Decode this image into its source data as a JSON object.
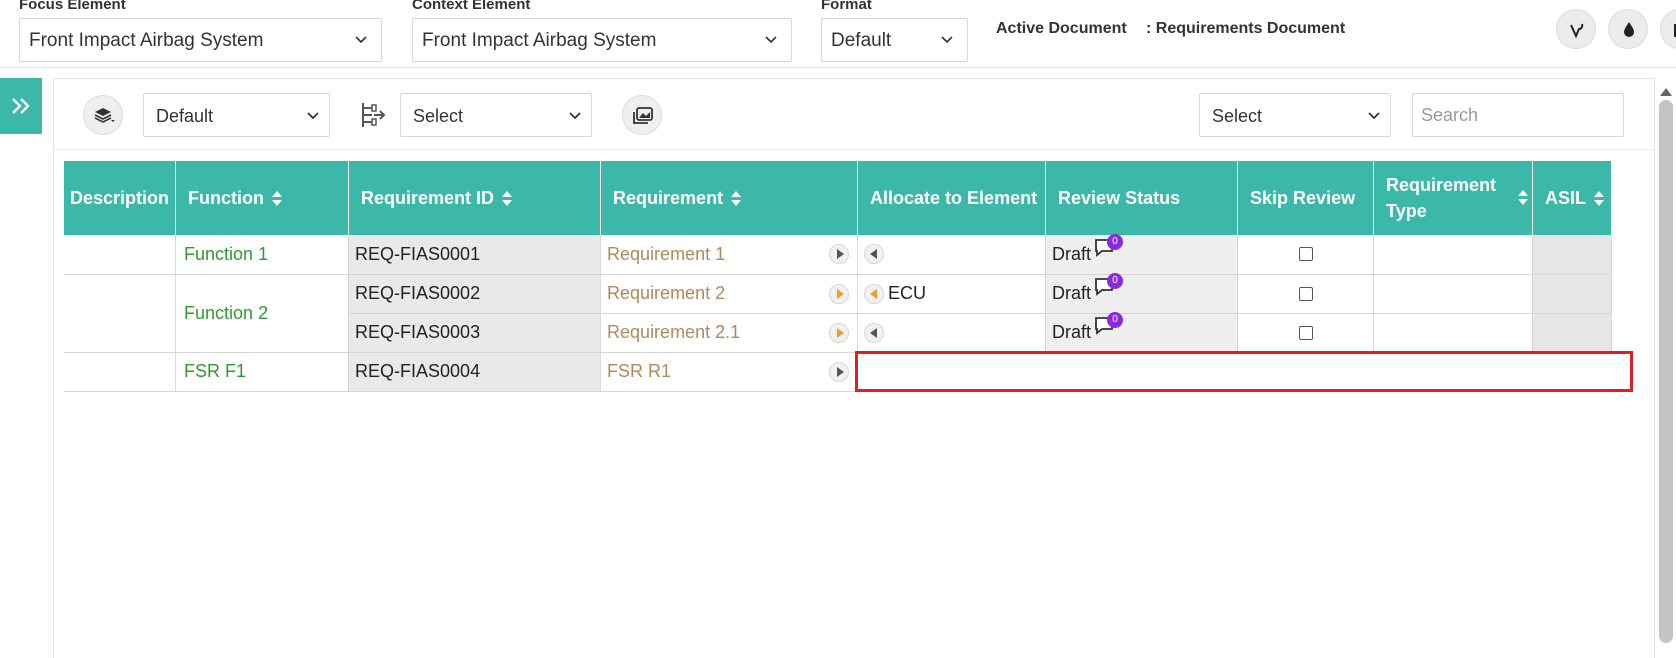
{
  "top": {
    "focus_label": "Focus Element",
    "focus_value": "Front Impact Airbag System",
    "context_label": "Context Element",
    "context_value": "Front Impact Airbag System",
    "format_label": "Format",
    "format_value": "Default",
    "active_doc_label": "Active Document",
    "active_doc_value": ": Requirements Document",
    "icons": [
      "vine-icon",
      "drop-icon",
      "partial-icon"
    ]
  },
  "toolbar": {
    "layer_select": "Default",
    "hierarchy_select": "Select",
    "right_select": "Select",
    "search_placeholder": "Search"
  },
  "table": {
    "headers": {
      "description": "Description",
      "function": "Function",
      "requirement_id": "Requirement ID",
      "requirement": "Requirement",
      "allocate": "Allocate to Element",
      "review_status": "Review Status",
      "skip_review": "Skip Review",
      "requirement_type": "Requirement Type",
      "asil": "ASIL"
    },
    "rows": [
      {
        "function": "Function 1",
        "id": "REQ-FIAS0001",
        "requirement": "Requirement 1",
        "allocate": "",
        "status": "Draft",
        "comments": "0"
      },
      {
        "function": "Function 2",
        "id": "REQ-FIAS0002",
        "requirement": "Requirement 2",
        "allocate": "ECU",
        "status": "Draft",
        "comments": "0"
      },
      {
        "function": "",
        "id": "REQ-FIAS0003",
        "requirement": "Requirement 2.1",
        "allocate": "",
        "status": "Draft",
        "comments": "0"
      },
      {
        "function": "FSR F1",
        "id": "REQ-FIAS0004",
        "requirement": "FSR R1",
        "allocate": "",
        "status": "",
        "comments": ""
      }
    ]
  },
  "colors": {
    "accent": "#3bb8a8",
    "function_text": "#2f9a2f",
    "requirement_text": "#b2875a",
    "badge": "#8a2be2",
    "highlight": "#e02020"
  }
}
